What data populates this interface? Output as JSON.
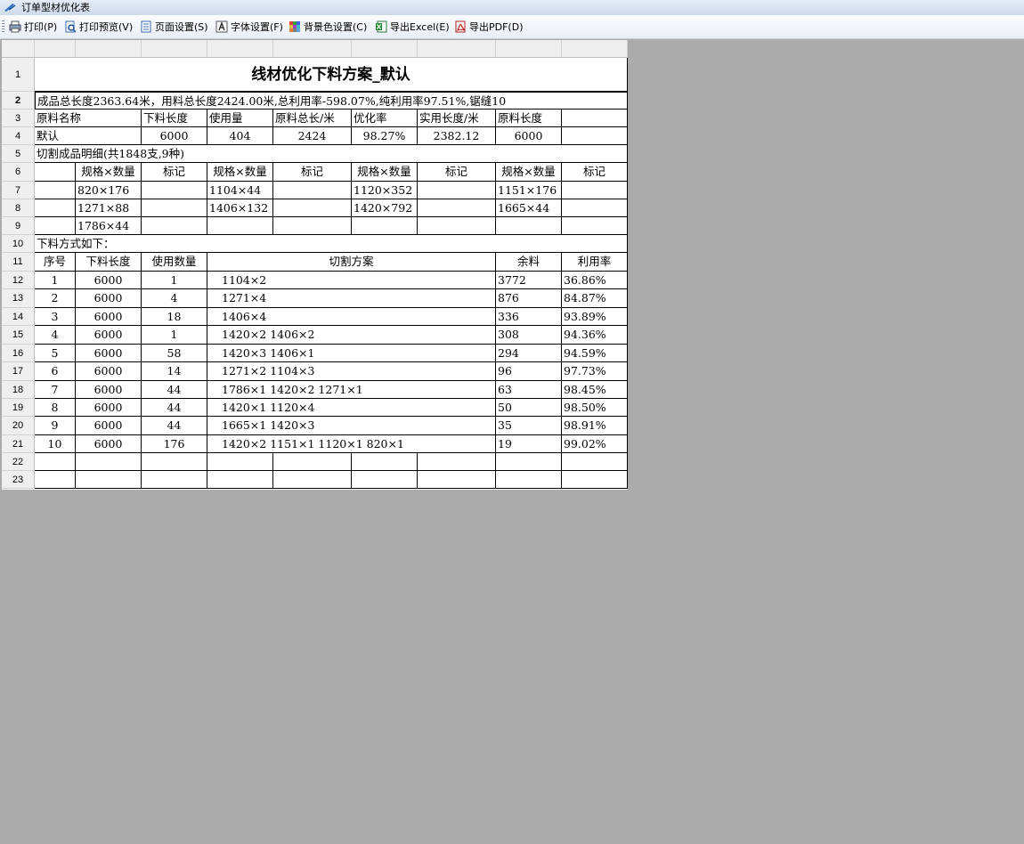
{
  "window": {
    "title": "订单型材优化表"
  },
  "toolbar": {
    "print": "打印(P)",
    "print_preview": "打印预览(V)",
    "page_setup": "页面设置(S)",
    "font_setup": "字体设置(F)",
    "bg_color": "背景色设置(C)",
    "export_excel": "导出Excel(E)",
    "export_pdf": "导出PDF(D)"
  },
  "rows": {
    "numbers": [
      "1",
      "2",
      "3",
      "4",
      "5",
      "6",
      "7",
      "8",
      "9",
      "10",
      "11",
      "12",
      "13",
      "14",
      "15",
      "16",
      "17",
      "18",
      "19",
      "20",
      "21",
      "22",
      "23"
    ]
  },
  "sheet": {
    "title": "线材优化下料方案_默认",
    "summary": "成品总长度2363.64米，用料总长度2424.00米,总利用率-598.07%,纯利用率97.51%,锯缝10",
    "material_headers": [
      "原料名称",
      "下料长度",
      "使用量",
      "原料总长/米",
      "优化率",
      "实用长度/米",
      "原料长度"
    ],
    "material_values": [
      "默认",
      "6000",
      "404",
      "2424",
      "98.27%",
      "2382.12",
      "6000"
    ],
    "detail_title": "切割成品明细(共1848支,9种)",
    "detail_headers": [
      "规格×数量",
      "标记",
      "规格×数量",
      "标记",
      "规格×数量",
      "标记",
      "规格×数量",
      "标记"
    ],
    "detail_rows": [
      [
        "820×176",
        "",
        "1104×44",
        "",
        "1120×352",
        "",
        "1151×176",
        ""
      ],
      [
        "1271×88",
        "",
        "1406×132",
        "",
        "1420×792",
        "",
        "1665×44",
        ""
      ],
      [
        "1786×44",
        "",
        "",
        "",
        "",
        "",
        "",
        ""
      ]
    ],
    "method_title": "下料方式如下：",
    "plan_headers": [
      "序号",
      "下料长度",
      "使用数量",
      "切割方案",
      "余料",
      "利用率"
    ],
    "plan_rows": [
      [
        "1",
        "6000",
        "1",
        "1104×2",
        "3772",
        "36.86%"
      ],
      [
        "2",
        "6000",
        "4",
        "1271×4",
        "876",
        "84.87%"
      ],
      [
        "3",
        "6000",
        "18",
        "1406×4",
        "336",
        "93.89%"
      ],
      [
        "4",
        "6000",
        "1",
        "1420×2  1406×2",
        "308",
        "94.36%"
      ],
      [
        "5",
        "6000",
        "58",
        "1420×3  1406×1",
        "294",
        "94.59%"
      ],
      [
        "6",
        "6000",
        "14",
        "1271×2  1104×3",
        "96",
        "97.73%"
      ],
      [
        "7",
        "6000",
        "44",
        "1786×1  1420×2  1271×1",
        "63",
        "98.45%"
      ],
      [
        "8",
        "6000",
        "44",
        "1420×1  1120×4",
        "50",
        "98.50%"
      ],
      [
        "9",
        "6000",
        "44",
        "1665×1  1420×3",
        "35",
        "98.91%"
      ],
      [
        "10",
        "6000",
        "176",
        "1420×2  1151×1  1120×1  820×1",
        "19",
        "99.02%"
      ]
    ]
  }
}
